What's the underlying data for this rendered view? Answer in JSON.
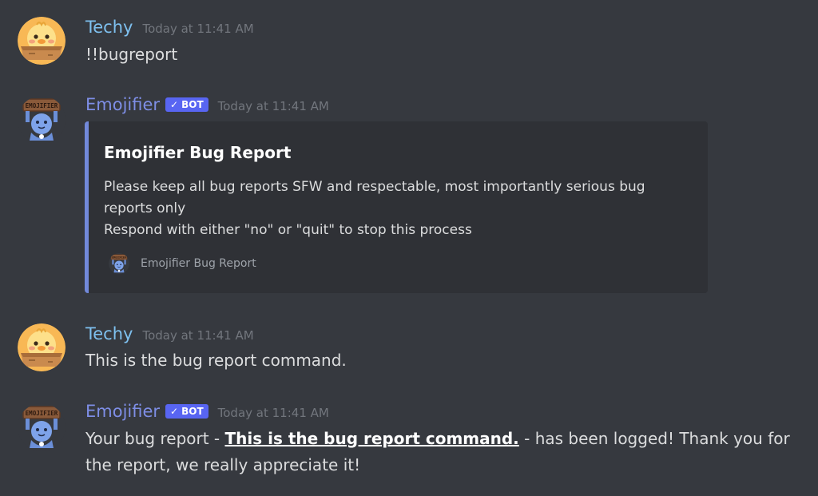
{
  "colors": {
    "background": "#36393f",
    "embed_background": "#2f3136",
    "embed_accent": "#7289da",
    "techy_name": "#7ec0ef",
    "bot_name": "#7e8ee6",
    "bot_tag": "#5865f2",
    "timestamp": "#72767d"
  },
  "messages": [
    {
      "author": "Techy",
      "avatar_icon": "duck-in-box-icon",
      "timestamp": "Today at 11:41 AM",
      "text": "!!bugreport"
    },
    {
      "author": "Emojifier",
      "avatar_icon": "bot-holding-sign-icon",
      "bot_tag": "BOT",
      "timestamp": "Today at 11:41 AM",
      "embed": {
        "title": "Emojifier Bug Report",
        "description_line1": "Please keep all bug reports SFW and respectable, most importantly serious bug reports only",
        "description_line2": "Respond with either \"no\" or \"quit\" to stop this process",
        "footer_text": "Emojifier Bug Report",
        "footer_icon": "bot-holding-sign-icon"
      }
    },
    {
      "author": "Techy",
      "avatar_icon": "duck-in-box-icon",
      "timestamp": "Today at 11:41 AM",
      "text": "This is the bug report command."
    },
    {
      "author": "Emojifier",
      "avatar_icon": "bot-holding-sign-icon",
      "bot_tag": "BOT",
      "timestamp": "Today at 11:41 AM",
      "text_before": "Your bug report - ",
      "text_highlight": "This is the bug report command.",
      "text_after": " - has been logged! Thank you for the report, we really appreciate it!"
    }
  ],
  "avatar_sign_text": "EMOJIFIER"
}
